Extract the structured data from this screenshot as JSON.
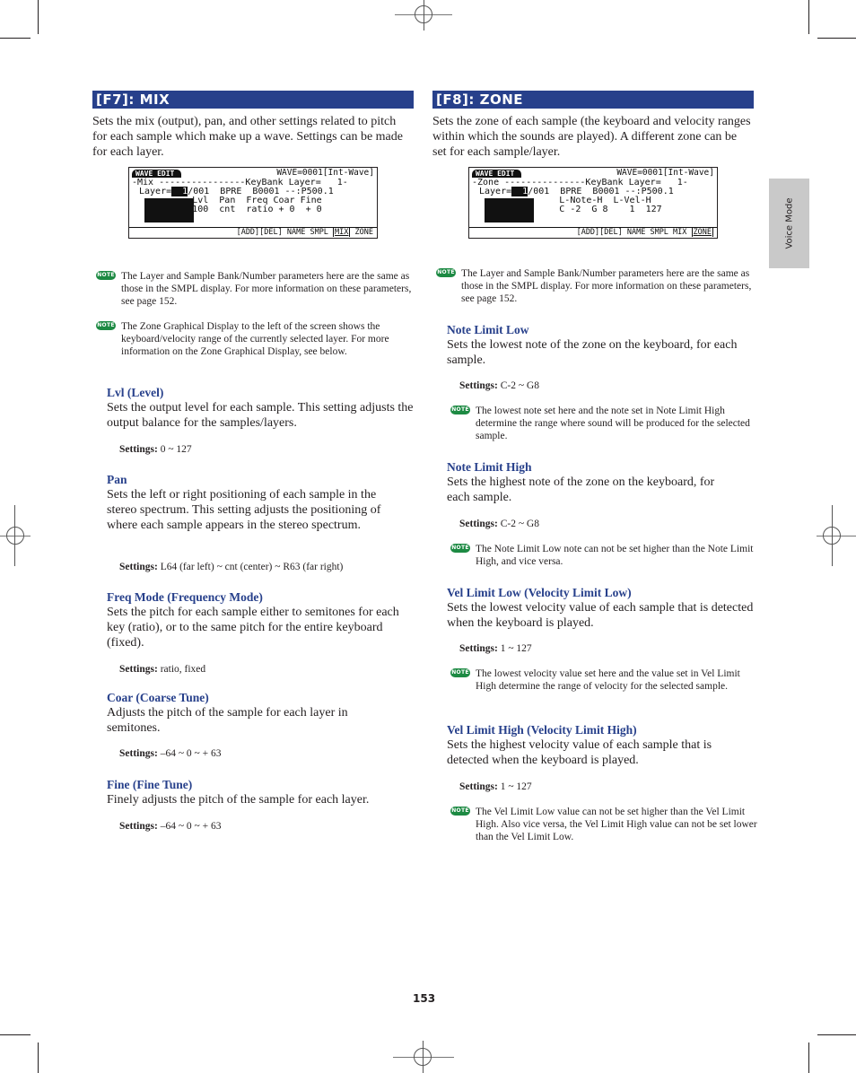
{
  "side_tab": "Voice Mode",
  "page_number": "153",
  "note_badge": "NOTE",
  "settings_label": "Settings:",
  "left": {
    "heading": "[F7]: MIX",
    "intro": "Sets the mix (output), pan, and other settings related to pitch for each sample which make up a wave. Settings can be made for each layer.",
    "lcd": {
      "tag": "WAVE EDIT",
      "wave": "WAVE=0001[Int-Wave]",
      "line1": "-Mix ----------------KeyBank Layer=   1-",
      "line2_pre": "Layer=",
      "line2_cursor": "  1",
      "line2_post": "/001  BPRE  B0001 --:P500.1",
      "line3": "         Lvl  Pan  Freq Coar Fine",
      "line4": "         100  cnt  ratio + 0  + 0",
      "menu_pre": "[ADD][DEL] NAME SMPL ",
      "menu_sel": "MIX",
      "menu_post": " ZONE"
    },
    "notes": [
      "The Layer and Sample Bank/Number parameters here are the same as those in the SMPL display. For more information on these parameters, see page 152.",
      "The Zone Graphical Display to the left of the screen shows the keyboard/velocity range of the currently selected layer. For more information on the Zone Graphical Display, see below."
    ],
    "params": [
      {
        "title": "Lvl (Level)",
        "desc": "Sets the output level for each sample. This setting adjusts the output balance for the samples/layers.",
        "settings": "0 ~ 127"
      },
      {
        "title": "Pan",
        "desc": "Sets the left or right positioning of each sample in the stereo spectrum. This setting adjusts the positioning of where each sample appears in the stereo spectrum.",
        "settings": "L64 (far left) ~ cnt (center) ~ R63 (far right)"
      },
      {
        "title": "Freq Mode (Frequency Mode)",
        "desc": "Sets the pitch for each sample either to semitones for each key (ratio), or to the same pitch for the entire keyboard (fixed).",
        "settings": "ratio, fixed"
      },
      {
        "title": "Coar (Coarse Tune)",
        "desc": "Adjusts the pitch of the sample for each layer in semitones.",
        "settings": "–64 ~ 0 ~ + 63"
      },
      {
        "title": "Fine (Fine Tune)",
        "desc": "Finely adjusts the pitch of the sample for each layer.",
        "settings": "–64 ~ 0 ~ + 63"
      }
    ]
  },
  "right": {
    "heading": "[F8]: ZONE",
    "intro": "Sets the zone of each sample (the keyboard and velocity ranges within which the sounds are played). A different zone can be set for each sample/layer.",
    "lcd": {
      "tag": "WAVE EDIT",
      "wave": "WAVE=0001[Int-Wave]",
      "line1": "-Zone ---------------KeyBank Layer=   1-",
      "line2_pre": "Layer=",
      "line2_cursor": "  1",
      "line2_post": "/001  BPRE  B0001 --:P500.1",
      "line3": "              L-Note-H  L-Vel-H",
      "line4": "              C -2  G 8    1  127",
      "menu_pre": "[ADD][DEL] NAME SMPL MIX ",
      "menu_sel": "ZONE",
      "menu_post": ""
    },
    "notes": [
      "The Layer and Sample Bank/Number parameters here are the same as those in the SMPL display. For more information on these parameters, see page 152.",
      "The lowest note set here and the note set in Note Limit High determine the range where sound will be produced for the selected sample.",
      "The Note Limit Low note can not be set higher than the Note Limit High, and vice versa.",
      "The lowest velocity value set here and the value set in Vel Limit High determine the range of velocity for the selected sample.",
      "The Vel Limit Low value can not be set higher than the Vel Limit High. Also vice versa, the Vel Limit High value can not be set lower than the Vel Limit Low."
    ],
    "params": [
      {
        "title": "Note Limit Low",
        "desc": "Sets the lowest note of the zone on the keyboard, for each sample.",
        "settings": "C-2 ~ G8"
      },
      {
        "title": "Note Limit High",
        "desc": "Sets the highest note of the zone on the keyboard, for each sample.",
        "settings": "C-2 ~ G8"
      },
      {
        "title": "Vel Limit Low (Velocity Limit Low)",
        "desc": "Sets the lowest velocity value of each sample that is detected when the keyboard is played.",
        "settings": "1 ~ 127"
      },
      {
        "title": "Vel Limit High (Velocity Limit High)",
        "desc": "Sets the highest velocity value of each sample that is detected when the keyboard is played.",
        "settings": "1 ~ 127"
      }
    ]
  }
}
